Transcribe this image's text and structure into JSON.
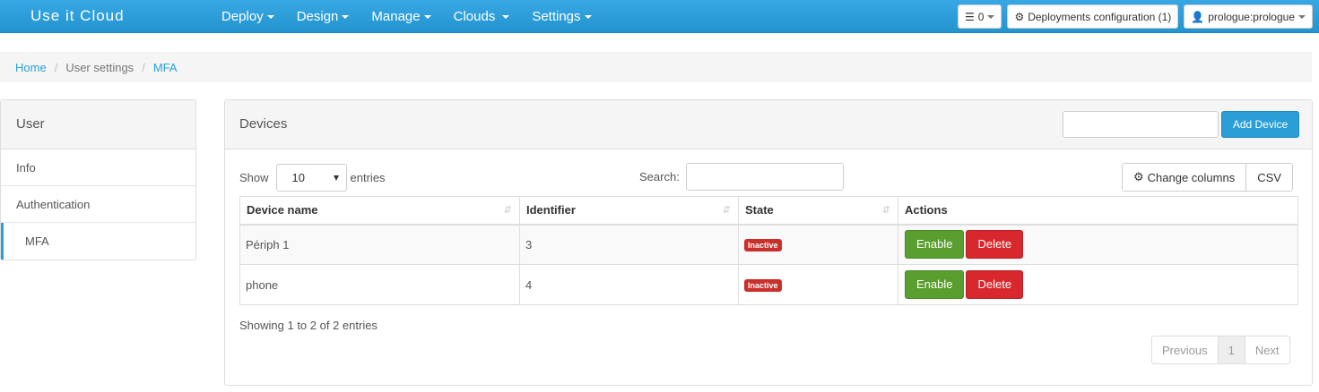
{
  "navbar": {
    "brand": "Use it Cloud",
    "menu": [
      {
        "label": "Deploy"
      },
      {
        "label": "Design"
      },
      {
        "label": "Manage"
      },
      {
        "label": "Clouds"
      },
      {
        "label": "Settings"
      }
    ],
    "queue_count": "0",
    "deployments_config": "Deployments configuration (1)",
    "user": "prologue:prologue",
    "accent_color": "#2a9fd6"
  },
  "breadcrumb": {
    "home": "Home",
    "user_settings": "User settings",
    "current": "MFA",
    "separator": "/"
  },
  "sidebar": {
    "title": "User",
    "items": [
      {
        "label": "Info"
      },
      {
        "label": "Authentication"
      },
      {
        "label": "MFA"
      }
    ]
  },
  "panel": {
    "title": "Devices",
    "add_device_value": "",
    "add_device_button": "Add Device",
    "show_label": "Show",
    "entries_select": "10",
    "entries_label": "entries",
    "search_label": "Search:",
    "search_value": "",
    "change_columns": "Change columns",
    "csv": "CSV",
    "columns": [
      "Device name",
      "Identifier",
      "State",
      "Actions"
    ],
    "rows": [
      {
        "name": "Périph 1",
        "identifier": "3",
        "state": "Inactive",
        "enable": "Enable",
        "delete": "Delete"
      },
      {
        "name": "phone",
        "identifier": "4",
        "state": "Inactive",
        "enable": "Enable",
        "delete": "Delete"
      }
    ],
    "info": "Showing 1 to 2 of 2 entries",
    "pagination": {
      "previous": "Previous",
      "page": "1",
      "next": "Next"
    }
  }
}
